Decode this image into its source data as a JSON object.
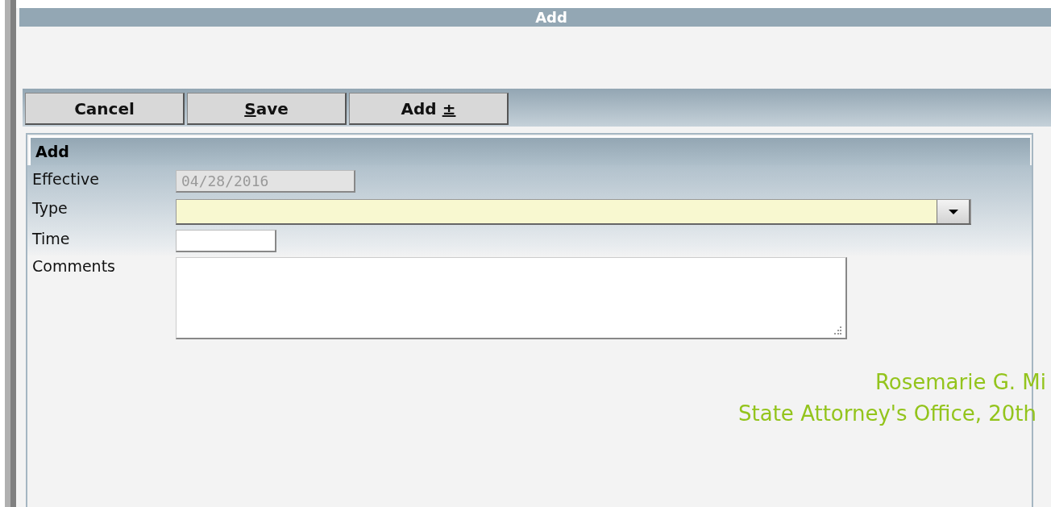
{
  "window": {
    "title": "Add"
  },
  "toolbar": {
    "buttons": [
      {
        "label": "Cancel",
        "underline_first": false,
        "underline_last": false
      },
      {
        "label": "Save",
        "underline_first": true,
        "underline_last": false
      },
      {
        "label": "Add ±",
        "underline_first": false,
        "underline_last": true
      }
    ]
  },
  "panel": {
    "title": "Add",
    "fields": [
      {
        "label": "Effective",
        "kind": "text",
        "value": "04/28/2016",
        "disabled": true
      },
      {
        "label": "Type",
        "kind": "select",
        "required": true
      },
      {
        "label": "Time",
        "kind": "text",
        "disabled": false
      },
      {
        "label": "Comments",
        "kind": "textarea"
      }
    ]
  },
  "footer": {
    "lines": [
      "Rosemarie G. Mi",
      "State Attorney's Office, 20th"
    ]
  }
}
